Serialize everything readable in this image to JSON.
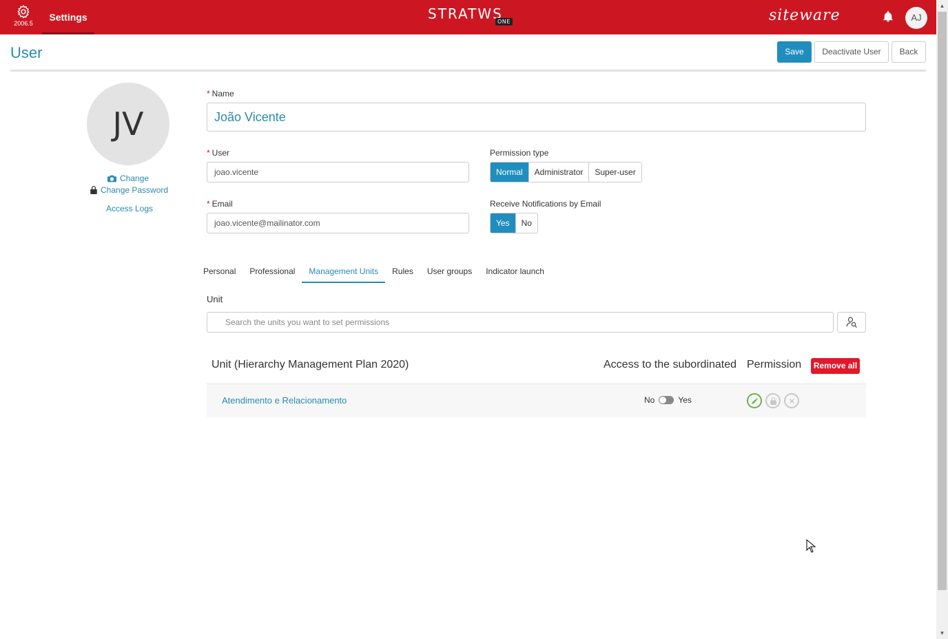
{
  "topbar": {
    "version": "2006.5",
    "settings_label": "Settings",
    "logo_text": "STRATWS",
    "logo_badge": "ONE",
    "brand": "siteware",
    "user_initials": "AJ",
    "color": "#cc1722"
  },
  "header": {
    "title": "User",
    "save_label": "Save",
    "deactivate_label": "Deactivate User",
    "back_label": "Back"
  },
  "profile": {
    "initials": "JV",
    "change_label": "Change",
    "change_password_label": "Change Password",
    "access_logs_label": "Access Logs"
  },
  "form": {
    "name_label": "Name",
    "name_value": "João Vicente",
    "user_label": "User",
    "user_value": "joao.vicente",
    "email_label": "Email",
    "email_value": "joao.vicente@mailinator.com",
    "permission_label": "Permission type",
    "permission_options": [
      "Normal",
      "Administrator",
      "Super-user"
    ],
    "notif_label": "Receive Notifications by Email",
    "notif_options": [
      "Yes",
      "No"
    ]
  },
  "tabs": [
    "Personal",
    "Professional",
    "Management Units",
    "Rules",
    "User groups",
    "Indicator launch"
  ],
  "units": {
    "unit_label": "Unit",
    "search_placeholder": "Search the units you want to set permissions",
    "col_unit": "Unit (Hierarchy Management Plan 2020)",
    "col_access": "Access to the subordinated",
    "col_permission": "Permission",
    "remove_all_label": "Remove all",
    "rows": [
      {
        "unit": "Atendimento e Relacionamento",
        "no_label": "No",
        "yes_label": "Yes"
      }
    ]
  }
}
